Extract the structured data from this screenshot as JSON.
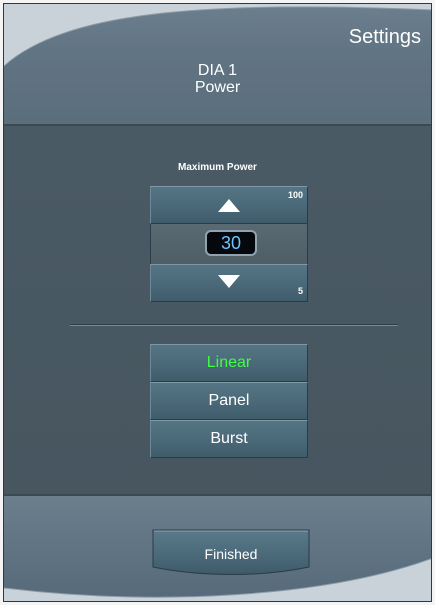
{
  "header": {
    "settings_title": "Settings",
    "device_name": "DIA 1",
    "device_subtitle": "Power"
  },
  "power_control": {
    "label": "Maximum Power",
    "value": "30",
    "max_label": "100",
    "min_label": "5",
    "increase_icon": "triangle-up-icon",
    "decrease_icon": "triangle-down-icon"
  },
  "modes": {
    "items": [
      "Linear",
      "Panel",
      "Burst"
    ],
    "selected": "Linear",
    "selected_color": "#3dff45"
  },
  "footer": {
    "finished_label": "Finished"
  },
  "colors": {
    "background": "#44535e",
    "header": "#617483",
    "button": "#4a6878",
    "value_text": "#6ec3ff"
  }
}
